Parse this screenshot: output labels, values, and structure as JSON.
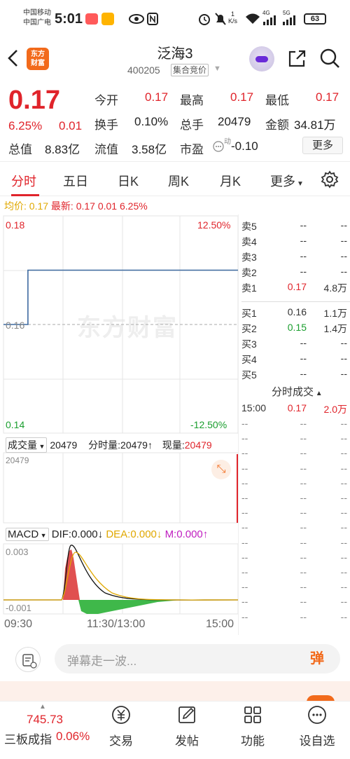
{
  "status_bar": {
    "carrier1": "中国移动",
    "carrier2": "中国广电",
    "time": "5:01",
    "net_speed_value": "1",
    "net_speed_unit": "K/s",
    "net_4g": "4G",
    "net_5g": "5G",
    "battery": "63"
  },
  "header": {
    "logo_text": "东方财富",
    "name": "泛海3",
    "code": "400205",
    "badge": "集合竞价"
  },
  "quote": {
    "price": "0.17",
    "change_pct": "6.25%",
    "change": "0.01",
    "items": {
      "open_label": "今开",
      "open": "0.17",
      "high_label": "最高",
      "high": "0.17",
      "low_label": "最低",
      "low": "0.17",
      "turnover_label": "换手",
      "turnover": "0.10%",
      "volume_label": "总手",
      "volume": "20479",
      "amount_label": "金额",
      "amount": "34.81万",
      "mktcap_label": "总值",
      "mktcap": "8.83亿",
      "float_label": "流值",
      "float": "3.58亿",
      "pe_label": "市盈",
      "pe_sup": "动",
      "pe": "-0.10"
    },
    "more_label": "更多"
  },
  "tabs": [
    "分时",
    "五日",
    "日K",
    "周K",
    "月K",
    "更多"
  ],
  "avg_line": {
    "avg_label": "均价:",
    "avg": "0.17",
    "latest_label": "最新:",
    "latest": "0.17",
    "chg": "0.01",
    "pct": "6.25%"
  },
  "chart": {
    "watermark": "东方财富",
    "y_max": "0.18",
    "y_pct_max": "12.50%",
    "y_mid": "0.16",
    "y_min": "0.14",
    "y_pct_min": "-12.50%",
    "volume_label": "成交量",
    "volume_total": "20479",
    "min_vol_label": "分时量:",
    "min_vol": "20479",
    "cur_vol_label": "现量:",
    "cur_vol": "20479",
    "vol_axis_max": "20479",
    "macd_label": "MACD",
    "dif_label": "DIF:",
    "dif": "0.000",
    "dea_label": "DEA:",
    "dea": "0.000",
    "m_label": "M:",
    "m": "0.000",
    "macd_max": "0.003",
    "macd_min": "-0.001",
    "time_start": "09:30",
    "time_mid": "11:30/13:00",
    "time_end": "15:00"
  },
  "chart_data": {
    "type": "line",
    "x": [
      "09:30",
      "09:55",
      "15:00"
    ],
    "series": [
      {
        "values": [
          0.16,
          0.17,
          0.17
        ]
      }
    ],
    "ylim": [
      0.14,
      0.18
    ],
    "grid": true
  },
  "order_book": {
    "asks": [
      {
        "label": "卖5",
        "price": "--",
        "vol": "--"
      },
      {
        "label": "卖4",
        "price": "--",
        "vol": "--"
      },
      {
        "label": "卖3",
        "price": "--",
        "vol": "--"
      },
      {
        "label": "卖2",
        "price": "--",
        "vol": "--"
      },
      {
        "label": "卖1",
        "price": "0.17",
        "vol": "4.8万"
      }
    ],
    "bids": [
      {
        "label": "买1",
        "price": "0.16",
        "vol": "1.1万"
      },
      {
        "label": "买2",
        "price": "0.15",
        "vol": "1.4万"
      },
      {
        "label": "买3",
        "price": "--",
        "vol": "--"
      },
      {
        "label": "买4",
        "price": "--",
        "vol": "--"
      },
      {
        "label": "买5",
        "price": "--",
        "vol": "--"
      }
    ],
    "ticks_header": "分时成交",
    "ticks": [
      {
        "time": "15:00",
        "price": "0.17",
        "vol": "2.0万"
      }
    ],
    "empty": "--"
  },
  "comment": {
    "placeholder": "弹幕走一波...",
    "danmu": "弹"
  },
  "bottom_nav": {
    "index_value": "745.73",
    "index_name": "三板成指",
    "index_pct": "0.06%",
    "items": [
      "交易",
      "发帖",
      "功能",
      "设自选"
    ]
  },
  "colors": {
    "up": "#e0242b",
    "down": "#1a9e2e",
    "price_line": "#3d6aa0",
    "brand": "#f26a1b"
  }
}
